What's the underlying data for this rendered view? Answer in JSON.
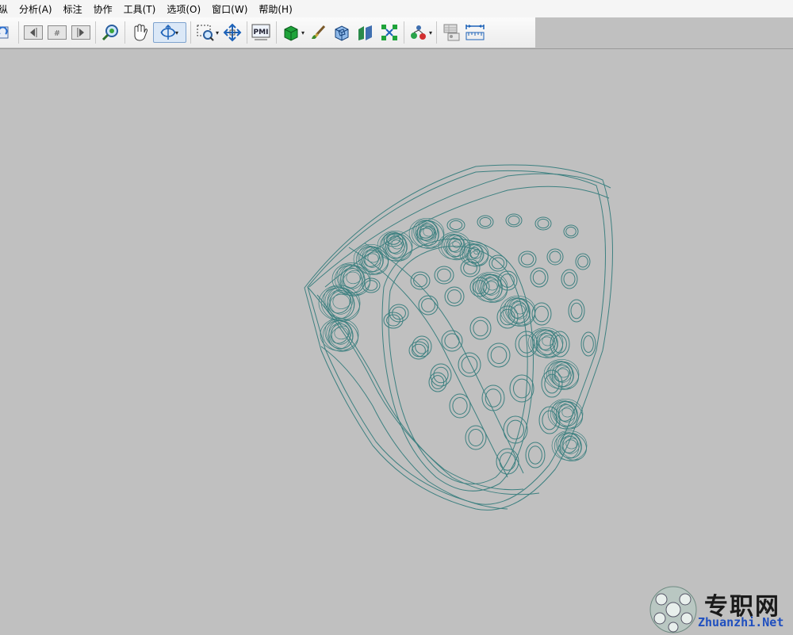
{
  "menubar": {
    "items": [
      {
        "label": "纵"
      },
      {
        "label": "分析(A)"
      },
      {
        "label": "标注"
      },
      {
        "label": "协作"
      },
      {
        "label": "工具(T)"
      },
      {
        "label": "选项(O)"
      },
      {
        "label": "窗口(W)"
      },
      {
        "label": "帮助(H)"
      }
    ]
  },
  "toolbar": {
    "pmi_label": "PMI",
    "icons": [
      "refresh-view-icon",
      "prev-view-icon",
      "view-grid-icon",
      "next-view-icon",
      "zoom-fit-icon",
      "pan-hand-icon",
      "rotate-icon",
      "zoom-window-icon",
      "move-icon",
      "pmi-icon",
      "solid-box-icon",
      "paint-brush-icon",
      "wireframe-box-icon",
      "section-icon",
      "explode-icon",
      "assembly-icon",
      "measure-table-icon",
      "measure-ruler-icon"
    ],
    "active_tool": "rotate-icon"
  },
  "viewport": {
    "background": "#c0c0c0",
    "wire_color": "#3d8080",
    "model": "wireframe ring"
  },
  "watermark": {
    "cn": "专职网",
    "en": "Zhuanzhi.Net"
  }
}
